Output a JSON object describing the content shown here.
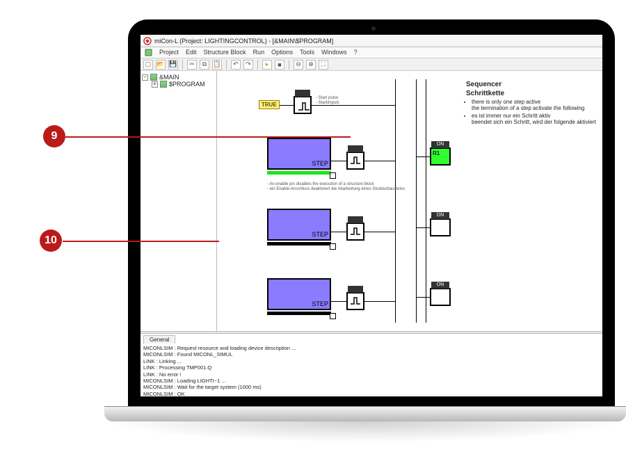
{
  "window": {
    "title": "miCon-L  (Project: LIGHTINGCONTROL)  - [&MAIN\\$PROGRAM]"
  },
  "menu": {
    "items": [
      "Project",
      "Edit",
      "Structure Block",
      "Run",
      "Options",
      "Tools",
      "Windows",
      "?"
    ]
  },
  "tree": {
    "root": "&MAIN",
    "child": "$PROGRAM"
  },
  "diagram": {
    "true_label": "TRUE",
    "start_lines": "- Start pulse\n- Startimpuls",
    "step_label": "STEP",
    "step_note": "- An enable pin disables the execution of a structure block\n- ein Enable-Anschluss deaktiviert die Abarbeitung eines Strukturbausteins",
    "side_r1": "R1",
    "side_on": "ON"
  },
  "doc": {
    "title_en": "Sequencer",
    "title_de": "Schrittkette",
    "bullet_en_1": "there is only one step active",
    "bullet_en_2": "the termination of a step activate the following",
    "bullet_de_1": "es ist immer nur ein Schritt aktiv",
    "bullet_de_2": "beendet sich ein Schritt, wird der folgende aktiviert"
  },
  "console": {
    "tab": "General",
    "lines": [
      "MICONLSIM : Request resource and loading device description ...",
      "MICONLSIM : Found MICONL_SIMUL",
      "LINK : Linking ...",
      "LINK : Processing TMP001.Q",
      "LINK : No error !",
      "MICONLSIM : Loading LIGHTI~1 ...",
      "MICONLSIM : Wait for the target system (1000 ms)",
      "MICONLSIM : OK"
    ]
  },
  "callouts": {
    "nine": "9",
    "ten": "10"
  }
}
